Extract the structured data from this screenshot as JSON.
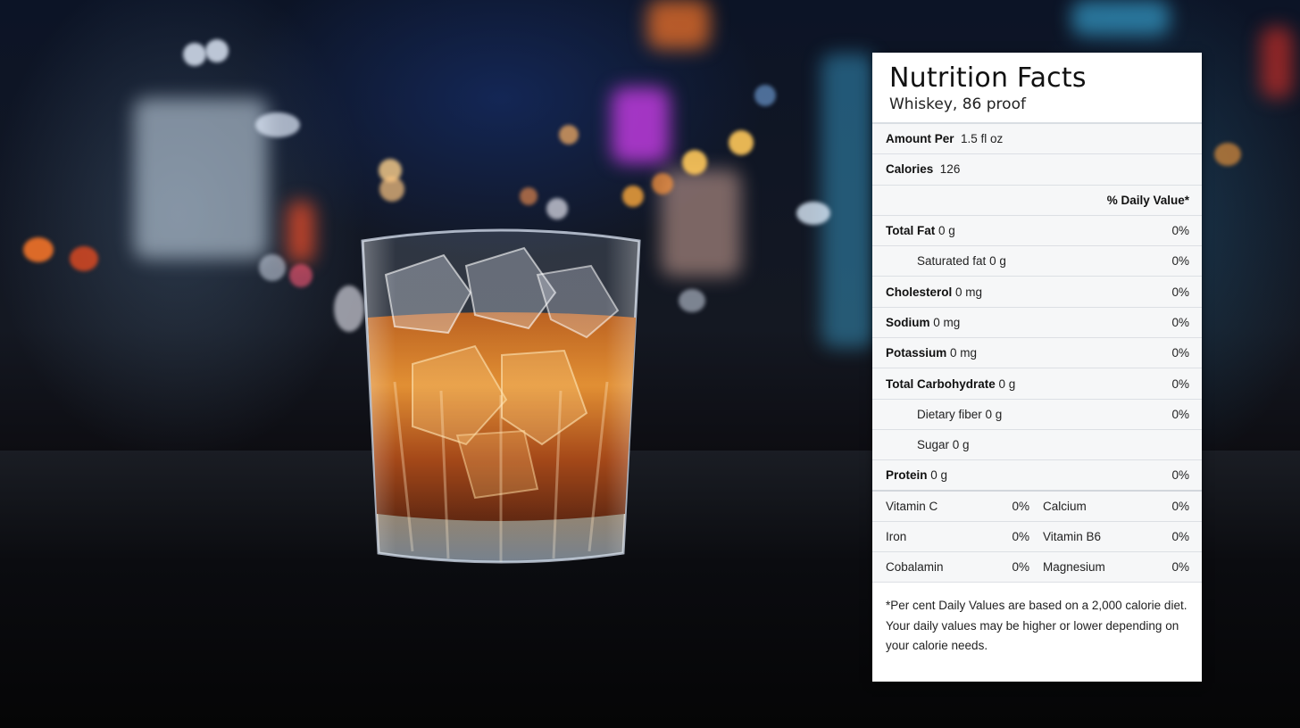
{
  "nutrition": {
    "title": "Nutrition Facts",
    "subtitle": "Whiskey, 86 proof",
    "amount_per": {
      "label": "Amount Per",
      "value": "1.5 fl oz"
    },
    "calories": {
      "label": "Calories",
      "value": "126"
    },
    "daily_value_header": "% Daily Value*",
    "nutrients": [
      {
        "label": "Total Fat",
        "amount": "0 g",
        "pct": "0%"
      },
      {
        "label": "Saturated fat",
        "amount": "0 g",
        "pct": "0%"
      },
      {
        "label": "Cholesterol",
        "amount": "0 mg",
        "pct": "0%"
      },
      {
        "label": "Sodium",
        "amount": "0 mg",
        "pct": "0%"
      },
      {
        "label": "Potassium",
        "amount": "0 mg",
        "pct": "0%"
      },
      {
        "label": "Total Carbohydrate",
        "amount": "0 g",
        "pct": "0%"
      },
      {
        "label": "Dietary fiber",
        "amount": "0 g",
        "pct": "0%"
      },
      {
        "label": "Sugar",
        "amount": "0 g",
        "pct": ""
      },
      {
        "label": "Protein",
        "amount": "0 g",
        "pct": "0%"
      }
    ],
    "vitamins": [
      {
        "left_label": "Vitamin C",
        "left_pct": "0%",
        "right_label": "Calcium",
        "right_pct": "0%"
      },
      {
        "left_label": "Iron",
        "left_pct": "0%",
        "right_label": "Vitamin B6",
        "right_pct": "0%"
      },
      {
        "left_label": "Cobalamin",
        "left_pct": "0%",
        "right_label": "Magnesium",
        "right_pct": "0%"
      }
    ],
    "footnote": "*Per cent Daily Values are based on a 2,000 calorie diet. Your daily values may be higher or lower depending on your calorie needs."
  }
}
